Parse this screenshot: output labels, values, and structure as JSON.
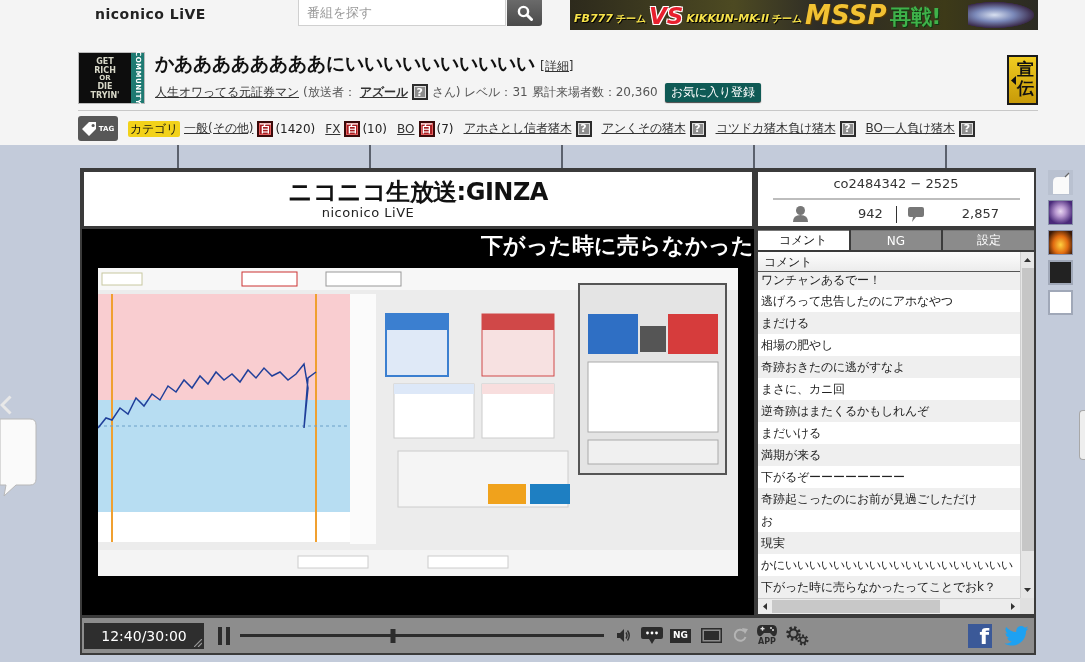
{
  "header": {
    "logo_subtitle": "niconico LiVE",
    "search": {
      "placeholder": "番組を探す"
    },
    "banner": {
      "items": [
        {
          "text": "FB777",
          "kind": "team"
        },
        {
          "text": "チーム",
          "kind": "suffix"
        },
        {
          "text": "VS",
          "kind": "versus"
        },
        {
          "text": "KIKKUN-MK-II",
          "kind": "team"
        },
        {
          "text": "チーム",
          "kind": "suffix"
        },
        {
          "text": "MSSP",
          "kind": "headline"
        },
        {
          "text": "再戦!",
          "kind": "accent"
        }
      ]
    }
  },
  "program": {
    "thumbnail": {
      "lines": [
        {
          "text": "GET",
          "kind": "major"
        },
        {
          "text": "RICH",
          "kind": "major"
        },
        {
          "text": "OR",
          "kind": "minor"
        },
        {
          "text": "DIE",
          "kind": "major"
        },
        {
          "text": "TRYIN'",
          "kind": "major"
        }
      ],
      "side_label": "COMMUNITY"
    },
    "title": "かああああああああにいいいいいいいいいい",
    "detail_link": "[詳細]",
    "community_link": "人生オワってる元証券マン",
    "broadcaster_prefix": "(放送者：",
    "broadcaster": "アズール",
    "broadcaster_mark": "?",
    "broadcaster_suffix": "さん)",
    "level": "レベル：31",
    "visitors": "累計来場者数：20,360",
    "favorite_button": "お気に入り登録",
    "promo_button": "宣伝"
  },
  "tags": {
    "badge": "TAG",
    "items": [
      {
        "category": "カテゴリ",
        "label": "一般(その他)",
        "kind": "article",
        "mark": "百",
        "count": "(1420)"
      },
      {
        "label": "FX",
        "kind": "article",
        "mark": "百",
        "count": "(10)"
      },
      {
        "label": "BO",
        "kind": "article",
        "mark": "百",
        "count": "(7)"
      },
      {
        "label": "アホさとし信者猪木",
        "kind": "no_article",
        "mark": "?"
      },
      {
        "label": "アンくその猪木",
        "kind": "no_article",
        "mark": "?"
      },
      {
        "label": "コツドカ猪木負け猪木",
        "kind": "no_article",
        "mark": "?"
      },
      {
        "label": "BO一人負け猪木",
        "kind": "no_article",
        "mark": "?"
      }
    ]
  },
  "player": {
    "logo": {
      "title": "ニコニコ生放送:GINZA",
      "subtitle": "niconico LiVE"
    },
    "overlay_comment": "下がった時に売らなかった",
    "room": "co2484342 − 2525",
    "viewers": "942",
    "comment_count": "2,857",
    "tabs": [
      {
        "label": "コメント",
        "selected": true
      },
      {
        "label": "NG",
        "selected": false
      },
      {
        "label": "設定",
        "selected": false
      }
    ],
    "list_header": "コメント",
    "comments": [
      "ワンチャンあるでー！",
      "逃げろって忠告したのにアホなやつ",
      "まだける",
      "相場の肥やし",
      "奇跡おきたのに逃がすなよ",
      "まさに、カニ回",
      "逆奇跡はまたくるかもしれんぞ",
      "まだいける",
      "満期が来る",
      "下がるぞーーーーーーーー",
      "奇跡起こったのにお前が見過ごしただけ",
      "お",
      "現実",
      "かにいいいいいいいいいいいいいいいいいいい",
      "下がった時に売らなかったってことでおk？"
    ],
    "time": "12:40/30:00",
    "seek": {
      "level": 0.42
    },
    "ng_button": "NG",
    "reload": {
      "disabled": true
    },
    "app_label": "APP",
    "facebook_label": "f"
  }
}
